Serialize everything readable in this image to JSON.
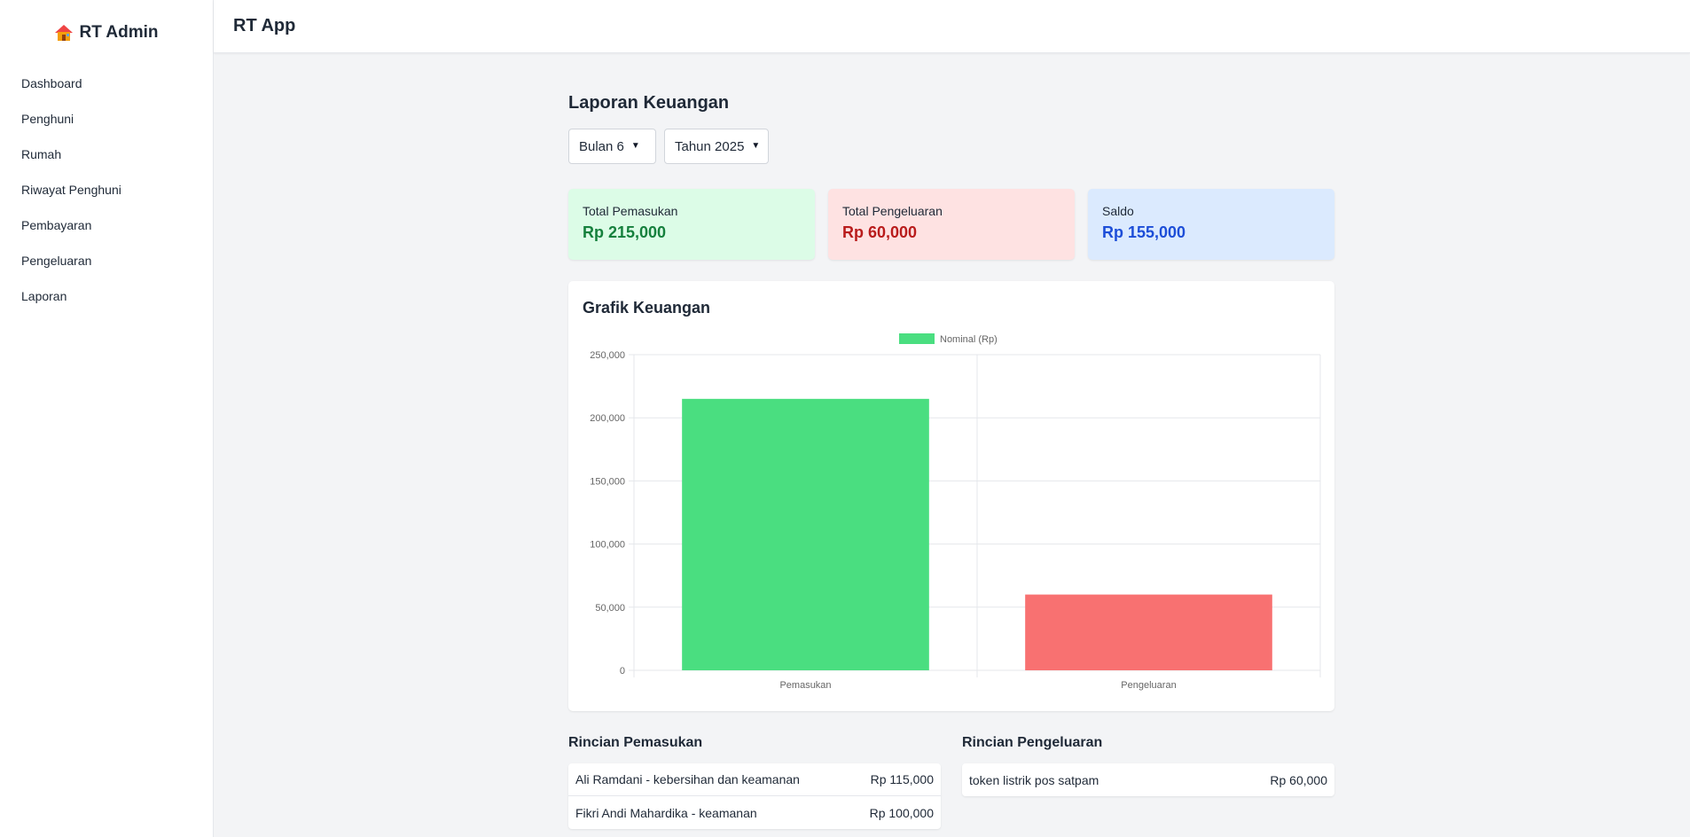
{
  "sidebar": {
    "brand": "RT Admin",
    "brand_icon": "house-icon",
    "items": [
      {
        "label": "Dashboard"
      },
      {
        "label": "Penghuni"
      },
      {
        "label": "Rumah"
      },
      {
        "label": "Riwayat Penghuni"
      },
      {
        "label": "Pembayaran"
      },
      {
        "label": "Pengeluaran"
      },
      {
        "label": "Laporan"
      }
    ]
  },
  "header": {
    "title": "RT App"
  },
  "page": {
    "title": "Laporan Keuangan",
    "filters": {
      "month": "Bulan 6",
      "year": "Tahun 2025"
    },
    "cards": [
      {
        "label": "Total Pemasukan",
        "value": "Rp 215,000",
        "bg": "#dcfce7",
        "color": "#15803d"
      },
      {
        "label": "Total Pengeluaran",
        "value": "Rp 60,000",
        "bg": "#fee2e2",
        "color": "#b91c1c"
      },
      {
        "label": "Saldo",
        "value": "Rp 155,000",
        "bg": "#dbeafe",
        "color": "#1d4ed8"
      }
    ],
    "chart_title": "Grafik Keuangan",
    "details": {
      "income_title": "Rincian Pemasukan",
      "income": [
        {
          "desc": "Ali Ramdani - kebersihan dan keamanan",
          "amount": "Rp 115,000"
        },
        {
          "desc": "Fikri Andi Mahardika - keamanan",
          "amount": "Rp 100,000"
        }
      ],
      "expense_title": "Rincian Pengeluaran",
      "expense": [
        {
          "desc": "token listrik pos satpam",
          "amount": "Rp 60,000"
        }
      ]
    }
  },
  "chart_data": {
    "type": "bar",
    "categories": [
      "Pemasukan",
      "Pengeluaran"
    ],
    "series": [
      {
        "name": "Nominal (Rp)",
        "values": [
          215000,
          60000
        ],
        "colors": [
          "#4ade80",
          "#f87171"
        ]
      }
    ],
    "legend": "top-center",
    "legend_color": "#4ade80",
    "ylim": [
      0,
      250000
    ],
    "yticks": [
      "0",
      "50,000",
      "100,000",
      "150,000",
      "200,000",
      "250,000"
    ],
    "ytick_values": [
      0,
      50000,
      100000,
      150000,
      200000,
      250000
    ],
    "grid": true
  }
}
